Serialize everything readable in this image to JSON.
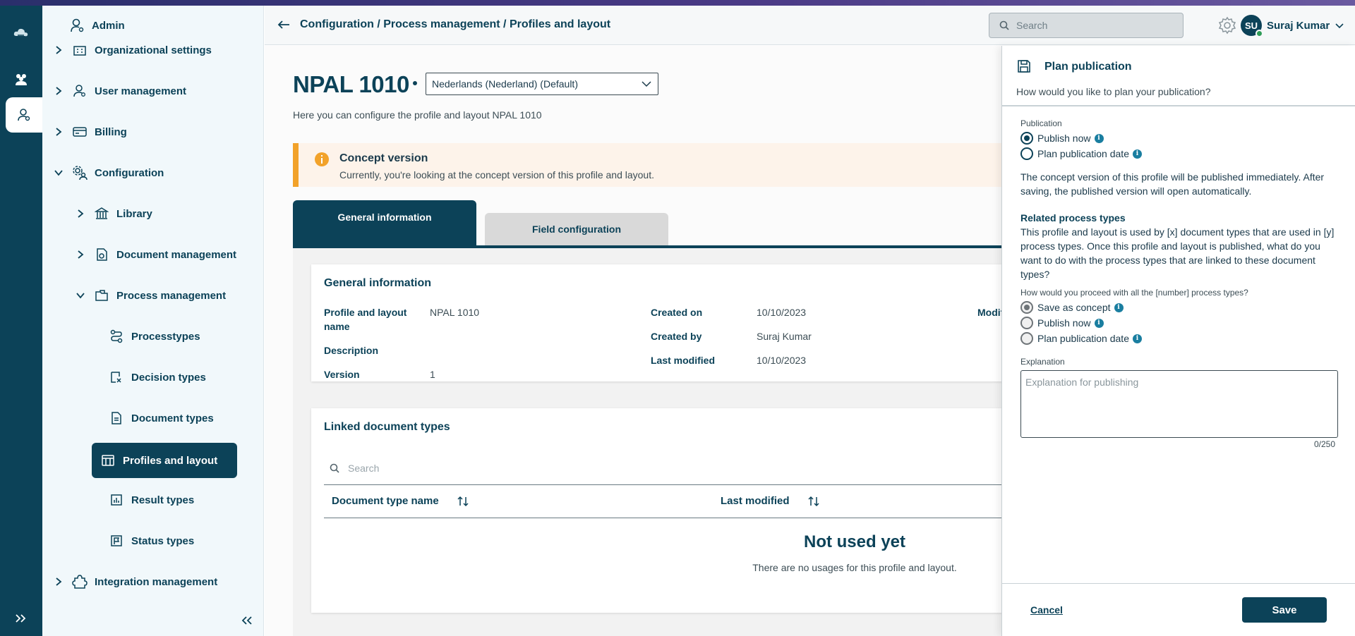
{
  "colors": {
    "primary": "#0c4258",
    "warning": "#f2a22a",
    "info": "#1a7ea0",
    "online": "#2e9c57"
  },
  "rail": {
    "icons": [
      "cloud-logo-icon",
      "team-icon",
      "admin-user-icon",
      "expand-icon"
    ]
  },
  "sidebar": {
    "header": "Admin",
    "items": [
      {
        "label": "Organizational settings",
        "icon": "building-icon",
        "level": 0
      },
      {
        "label": "User management",
        "icon": "user-icon",
        "level": 0
      },
      {
        "label": "Billing",
        "icon": "card-icon",
        "level": 0
      },
      {
        "label": "Configuration",
        "icon": "gear-user-icon",
        "level": 0,
        "expanded": true
      },
      {
        "label": "Library",
        "icon": "library-icon",
        "level": 1
      },
      {
        "label": "Document management",
        "icon": "document-gear-icon",
        "level": 1
      },
      {
        "label": "Process management",
        "icon": "folder-icon",
        "level": 1,
        "expanded": true
      },
      {
        "label": "Processtypes",
        "icon": "flow-icon",
        "level": 2
      },
      {
        "label": "Decision types",
        "icon": "decision-icon",
        "level": 2
      },
      {
        "label": "Document types",
        "icon": "doc-icon",
        "level": 2
      },
      {
        "label": "Profiles and layout",
        "icon": "layout-icon",
        "level": 2,
        "active": true
      },
      {
        "label": "Result types",
        "icon": "chart-icon",
        "level": 2
      },
      {
        "label": "Status types",
        "icon": "flag-icon",
        "level": 2
      },
      {
        "label": "Integration management",
        "icon": "puzzle-icon",
        "level": 0
      }
    ]
  },
  "topbar": {
    "breadcrumb": "Configuration / Process management / Profiles and layout",
    "search_placeholder": "Search",
    "user_initials": "SU",
    "user_name": "Suraj Kumar"
  },
  "main": {
    "title": "NPAL 1010",
    "language": "Nederlands (Nederland) (Default)",
    "subtitle": "Here you can configure the profile and layout NPAL 1010",
    "concept_title": "Concept version",
    "concept_text": "Currently, you're looking at the concept version of this profile and layout.",
    "tabs": [
      "General information",
      "Field configuration"
    ],
    "general": {
      "heading": "General information",
      "profile_label": "Profile and layout name",
      "profile_value": "NPAL 1010",
      "description_label": "Description",
      "version_label": "Version",
      "version_value": "1",
      "created_on_label": "Created on",
      "created_on_value": "10/10/2023",
      "created_by_label": "Created by",
      "created_by_value": "Suraj Kumar",
      "last_modified_label": "Last modified",
      "last_modified_value": "10/10/2023",
      "modified_truncated": "Modifi"
    },
    "linked": {
      "heading": "Linked document types",
      "search_placeholder": "Search",
      "col_name": "Document type name",
      "col_modified": "Last modified",
      "empty_title": "Not used yet",
      "empty_text": "There are no usages for this profile and layout."
    }
  },
  "drawer": {
    "title": "Plan publication",
    "subtitle": "How would you like to plan your publication?",
    "publication_label": "Publication",
    "opt_publish_now": "Publish now",
    "opt_plan_date": "Plan publication date",
    "publish_now_selected": true,
    "concept_note": "The concept version of this profile will be published immediately. After saving, the published version will open automatically.",
    "related_heading": "Related process types",
    "related_text": "This profile and layout is used by [x] document types that are used in [y] process types. Once this profile and layout is published, what do you want to do with the process types that are linked to these document types?",
    "proceed_label": "How would you proceed with all the [number] process types?",
    "opt_save_concept": "Save as concept",
    "opt_publish_now_2": "Publish now",
    "opt_plan_date_2": "Plan publication date",
    "explanation_label": "Explanation",
    "explanation_placeholder": "Explanation for publishing",
    "counter": "0/250",
    "cancel": "Cancel",
    "save": "Save"
  }
}
